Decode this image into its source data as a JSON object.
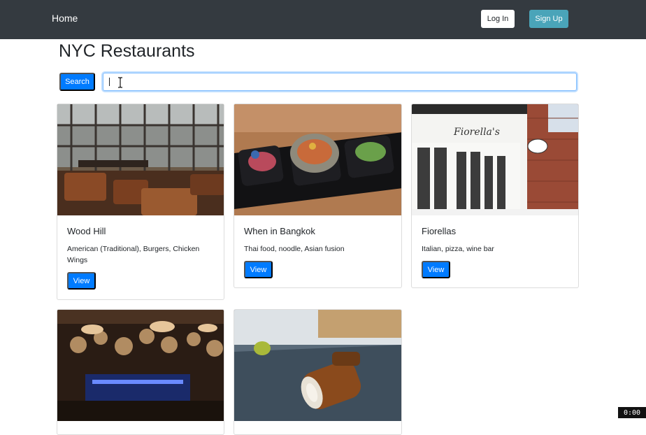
{
  "navbar": {
    "home_label": "Home",
    "login_label": "Log In",
    "signup_label": "Sign Up"
  },
  "page": {
    "title": "NYC Restaurants"
  },
  "search": {
    "button_label": "Search",
    "value": "",
    "placeholder": ""
  },
  "cards": [
    {
      "name": "Wood Hill",
      "description": "American (Traditional), Burgers, Chicken Wings",
      "view_label": "View"
    },
    {
      "name": "When in Bangkok",
      "description": "Thai food, noodle, Asian fusion",
      "view_label": "View"
    },
    {
      "name": "Fiorellas",
      "description": "Italian, pizza, wine bar",
      "view_label": "View",
      "sign_text": "Fiorella's"
    },
    {
      "name": "",
      "description": "",
      "view_label": ""
    },
    {
      "name": "",
      "description": "",
      "view_label": ""
    }
  ],
  "recorder_badge": "0:00",
  "colors": {
    "navbar": "#343a40",
    "primary": "#007bff",
    "signup": "#4aa4b9"
  }
}
